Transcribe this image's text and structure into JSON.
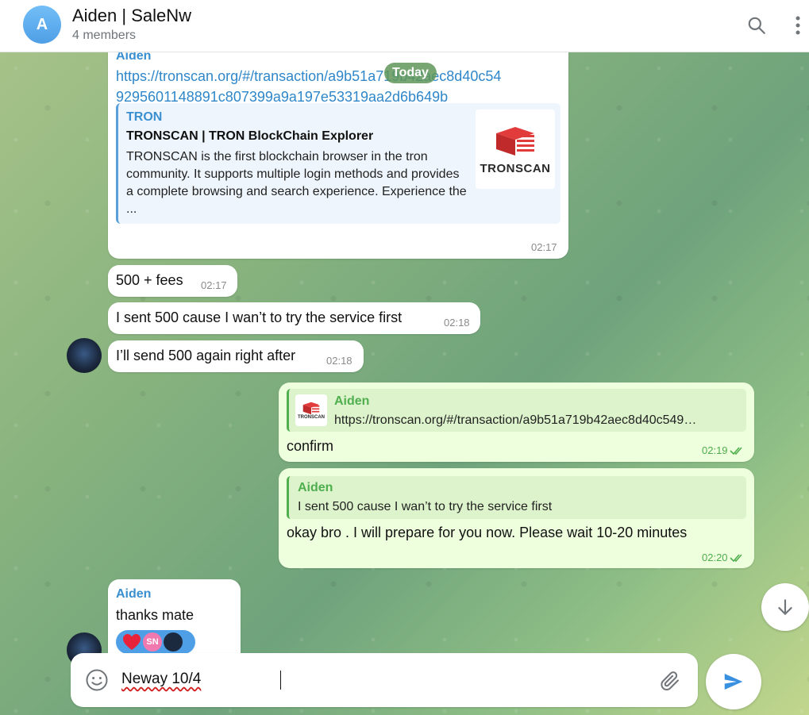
{
  "header": {
    "avatar_letter": "A",
    "title": "Aiden | SaleNw",
    "subtitle": "4 members",
    "search_icon": "search-icon",
    "more_icon": "more-vertical-icon"
  },
  "date_pill": "Today",
  "messages": [
    {
      "sender": "Aiden",
      "link_line1": "https://tronscan.org/#/transaction/a9b51a719b42aec8d40c54",
      "link_line2": "9295601148891c807399a9a197e53319aa2d6b649b",
      "preview": {
        "site": "TRON",
        "title": "TRONSCAN | TRON BlockChain Explorer",
        "description": "TRONSCAN is the first blockchain browser in the tron community. It supports multiple login methods and provides a complete browsing and search experience. Experience the ...",
        "thumb_label": "TRONSCAN"
      },
      "time": "02:17"
    },
    {
      "text": "500 + fees",
      "time": "02:17"
    },
    {
      "text": "I sent 500 cause I wan’t to try the service first",
      "time": "02:18"
    },
    {
      "text": "I’ll send 500 again right after",
      "time": "02:18"
    },
    {
      "outgoing": true,
      "quote_name": "Aiden",
      "quote_text": "https://tronscan.org/#/transaction/a9b51a719b42aec8d40c549…",
      "quote_thumb": "TRONSCAN",
      "text": "confirm",
      "time": "02:19"
    },
    {
      "outgoing": true,
      "quote_name": "Aiden",
      "quote_text": "I sent 500 cause I wan’t to try the service first",
      "text": "okay bro . I will prepare for you now. Please wait 10-20 minutes",
      "time": "02:20"
    },
    {
      "sender": "Aiden",
      "text": "thanks mate",
      "reaction_initials": "SN"
    }
  ],
  "composer": {
    "value": "Neway 10/4",
    "emoji_icon": "smile-icon",
    "attach_icon": "paperclip-icon",
    "send_icon": "send-icon"
  },
  "scroll_icon": "arrow-down-icon",
  "colors": {
    "accent": "#3a8fd0",
    "outgoing_bubble": "#eeffde",
    "outgoing_accent": "#4fae4e"
  }
}
